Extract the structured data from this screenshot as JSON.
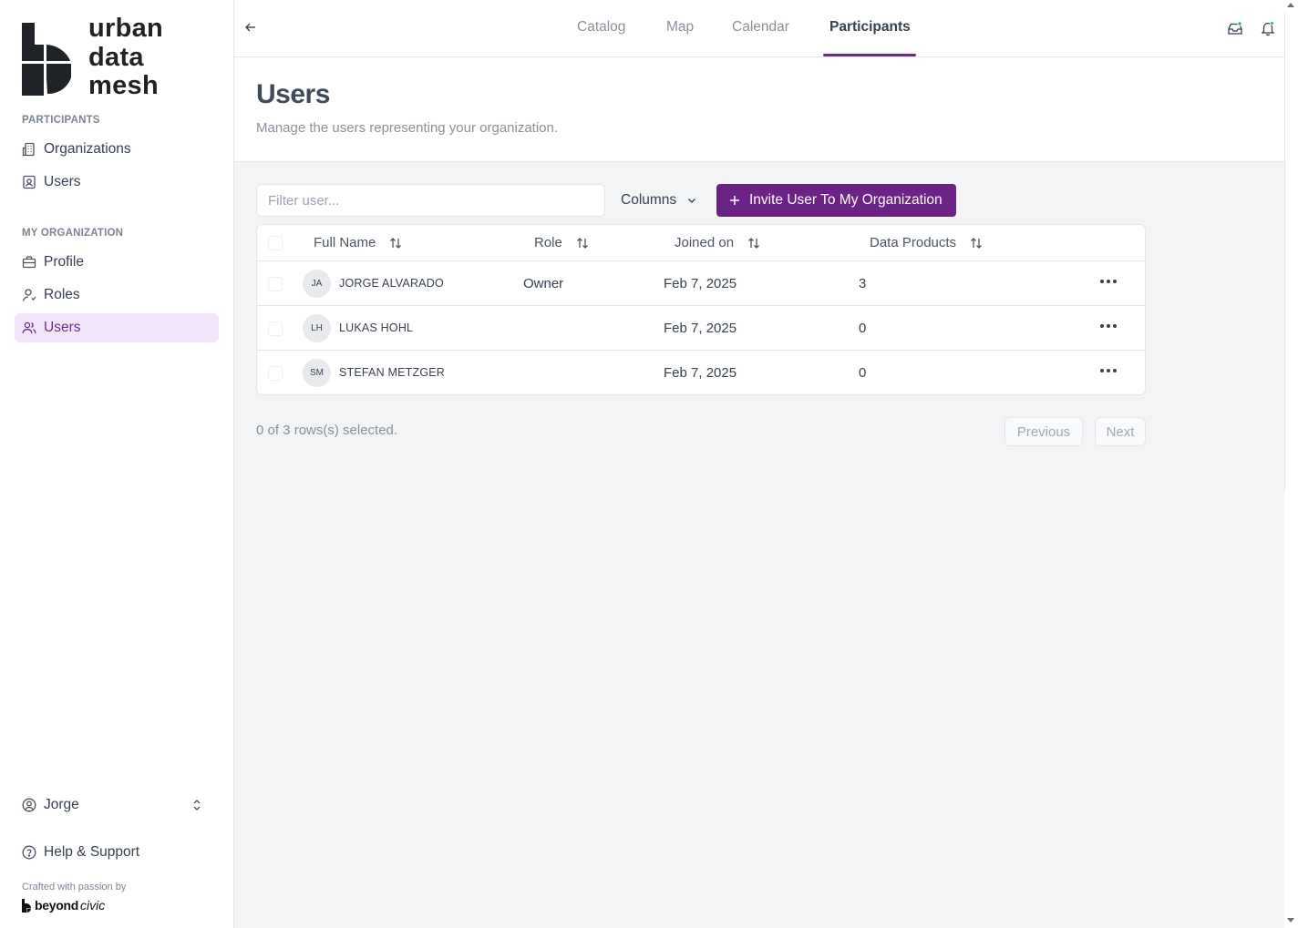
{
  "brand": {
    "line1": "urban",
    "line2": "data",
    "line3": "mesh"
  },
  "sidebar": {
    "section_participants": "PARTICIPANTS",
    "participants_items": [
      {
        "label": "Organizations",
        "icon": "building-icon"
      },
      {
        "label": "Users",
        "icon": "contact-icon"
      }
    ],
    "section_org": "MY ORGANIZATION",
    "org_items": [
      {
        "label": "Profile",
        "icon": "briefcase-icon"
      },
      {
        "label": "Roles",
        "icon": "user-icon"
      },
      {
        "label": "Users",
        "icon": "users-icon",
        "active": true
      }
    ],
    "user_name": "Jorge",
    "help": "Help & Support",
    "crafted": "Crafted with passion by",
    "beyond_bold": "beyond",
    "beyond_italic": "civic"
  },
  "topbar": {
    "tabs": [
      "Catalog",
      "Map",
      "Calendar",
      "Participants"
    ],
    "active_tab": "Participants"
  },
  "page": {
    "title": "Users",
    "subtitle": "Manage the users representing your organization."
  },
  "toolbar": {
    "filter_placeholder": "Filter user...",
    "columns_label": "Columns",
    "invite_label": "Invite User To My Organization"
  },
  "table": {
    "headers": [
      "Full Name",
      "Role",
      "Joined on",
      "Data Products"
    ],
    "rows": [
      {
        "initials": "JA",
        "name": "JORGE ALVARADO",
        "role": "Owner",
        "joined": "Feb 7, 2025",
        "products": "3"
      },
      {
        "initials": "LH",
        "name": "LUKAS HOHL",
        "role": "",
        "joined": "Feb 7, 2025",
        "products": "0"
      },
      {
        "initials": "SM",
        "name": "STEFAN METZGER",
        "role": "",
        "joined": "Feb 7, 2025",
        "products": "0"
      }
    ]
  },
  "footer": {
    "selected": "0 of 3 rows(s) selected.",
    "previous": "Previous",
    "next": "Next"
  },
  "colors": {
    "accent": "#6b2386",
    "active_bg": "#f3e8fb",
    "main_bg": "#f3f4f6"
  }
}
